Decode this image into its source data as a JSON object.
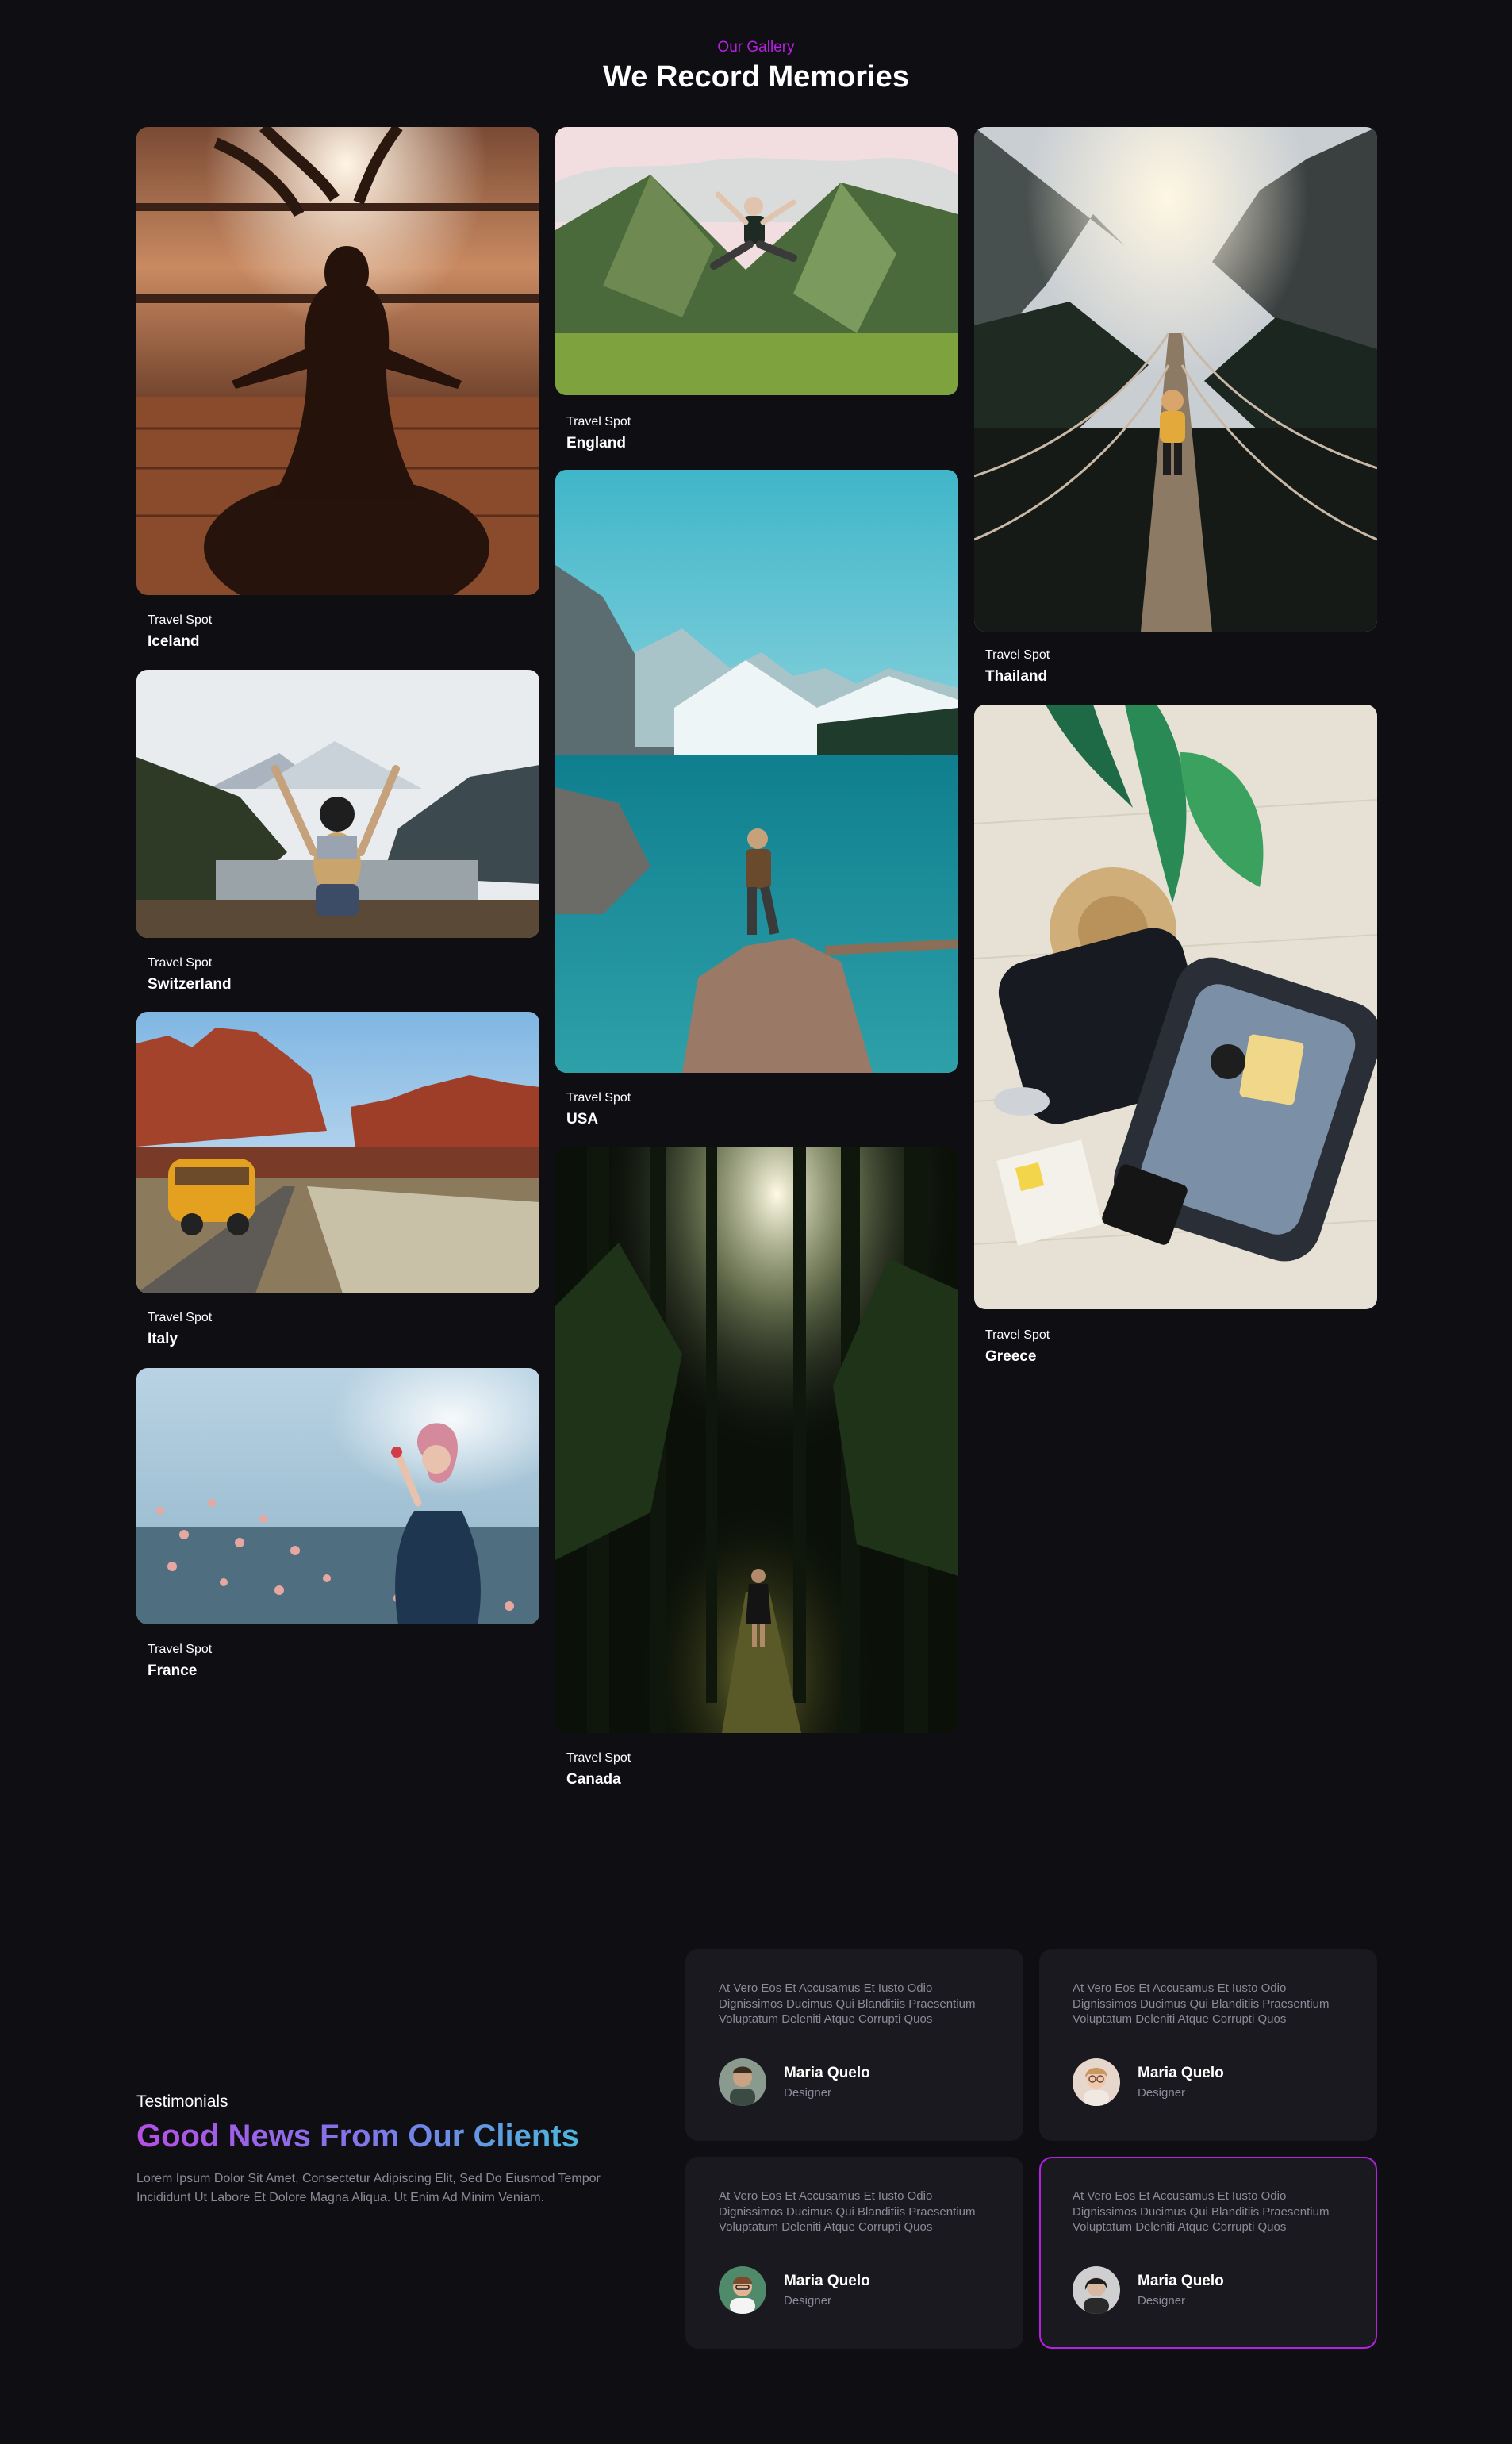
{
  "gallery": {
    "eyebrow": "Our Gallery",
    "headline": "We Record Memories",
    "items": [
      {
        "label": "Travel Spot",
        "name": "Iceland"
      },
      {
        "label": "Travel Spot",
        "name": "Switzerland"
      },
      {
        "label": "Travel Spot",
        "name": "Italy"
      },
      {
        "label": "Travel Spot",
        "name": "France"
      },
      {
        "label": "Travel Spot",
        "name": "England"
      },
      {
        "label": "Travel Spot",
        "name": "USA"
      },
      {
        "label": "Travel Spot",
        "name": "Canada"
      },
      {
        "label": "Travel Spot",
        "name": "Thailand"
      },
      {
        "label": "Travel Spot",
        "name": "Greece"
      }
    ]
  },
  "testimonials": {
    "eyebrow": "Testimonials",
    "headline": "Good News From Our Clients",
    "body": "Lorem Ipsum Dolor Sit Amet, Consectetur Adipiscing Elit, Sed Do Eiusmod Tempor Incididunt Ut Labore Et Dolore Magna Aliqua. Ut Enim Ad Minim Veniam.",
    "cards": [
      {
        "quote": "At Vero Eos Et Accusamus Et Iusto Odio Dignissimos Ducimus Qui Blanditiis Praesentium Voluptatum Deleniti Atque Corrupti Quos",
        "name": "Maria Quelo",
        "role": "Designer"
      },
      {
        "quote": "At Vero Eos Et Accusamus Et Iusto Odio Dignissimos Ducimus Qui Blanditiis Praesentium Voluptatum Deleniti Atque Corrupti Quos",
        "name": "Maria Quelo",
        "role": "Designer"
      },
      {
        "quote": "At Vero Eos Et Accusamus Et Iusto Odio Dignissimos Ducimus Qui Blanditiis Praesentium Voluptatum Deleniti Atque Corrupti Quos",
        "name": "Maria Quelo",
        "role": "Designer"
      },
      {
        "quote": "At Vero Eos Et Accusamus Et Iusto Odio Dignissimos Ducimus Qui Blanditiis Praesentium Voluptatum Deleniti Atque Corrupti Quos",
        "name": "Maria Quelo",
        "role": "Designer"
      }
    ]
  },
  "colors": {
    "background": "#0f0e13",
    "card_background": "#1a1920",
    "accent": "#b620e0",
    "muted_text": "#8c8a96"
  }
}
